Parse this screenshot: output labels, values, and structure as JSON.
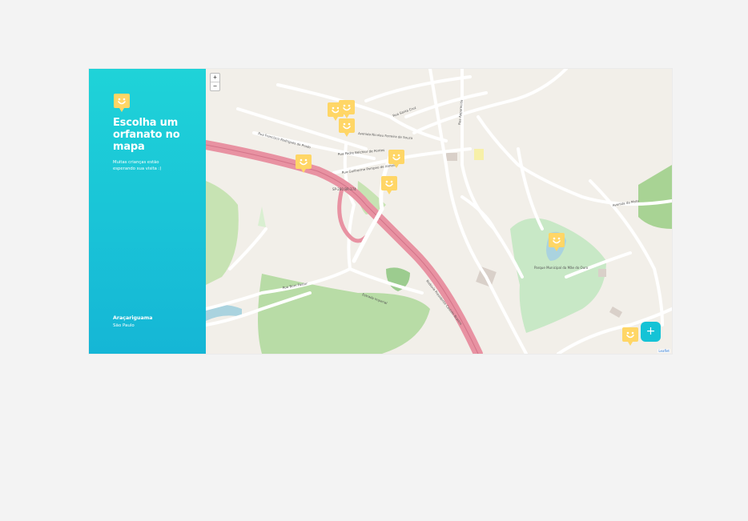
{
  "sidebar": {
    "title": "Escolha um orfanato no mapa",
    "subtitle": "Muitas crianças estão esperando sua visita :)",
    "city": "Araçariguama",
    "state": "São Paulo"
  },
  "map": {
    "zoom_in_label": "+",
    "zoom_out_label": "−",
    "attribution": "Leaflet",
    "road_labels": {
      "r1": "Rua Guilherme Pompeo de Almeida",
      "r2": "Rua Padre Belchior de Pontes",
      "r3": "Avenida Nicolau Ferreira de Souza",
      "r4": "Rua Francisco Rodrigues do Prado",
      "r5": "Estrada Imperial",
      "r6": "Rua Bom Pastor",
      "r7": "Rodovia Presidente Castelo Branco",
      "r8": "Avenida da Mata",
      "r9": "Parque Municipal da Mãe do Ouro",
      "r10": "Rua Santa Cruz",
      "r11": "Rua Apparecida",
      "r12": "SP-280 BR-374"
    }
  },
  "add_button": {
    "label": "+"
  },
  "colors": {
    "brand": "#15c3d6",
    "marker": "#ffd666",
    "highway": "#e892a2"
  }
}
